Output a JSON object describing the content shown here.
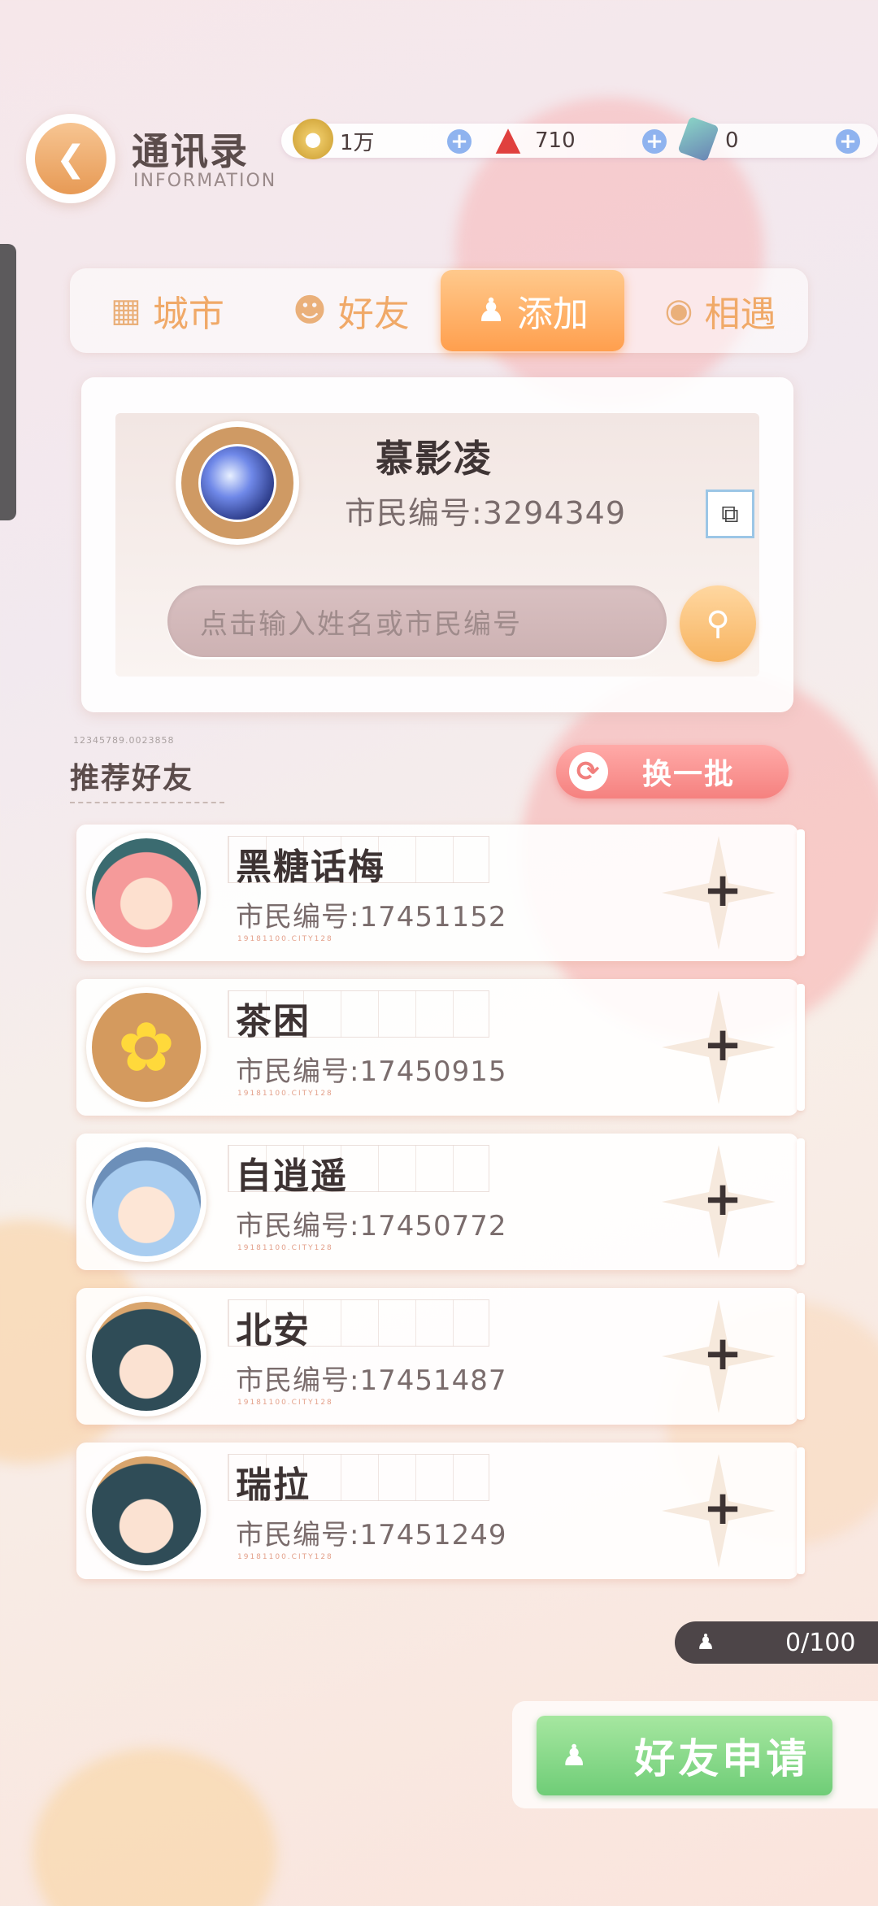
{
  "header": {
    "title": "通讯录",
    "subtitle": "INFORMATION"
  },
  "resources": [
    {
      "icon": "gold-coin-icon",
      "value": "1万"
    },
    {
      "icon": "fire-gem-icon",
      "value": "710"
    },
    {
      "icon": "card-ticket-icon",
      "value": "0"
    }
  ],
  "tabs": [
    {
      "label": "城市",
      "icon": "city-icon",
      "active": false
    },
    {
      "label": "好友",
      "icon": "friend-icon",
      "active": false
    },
    {
      "label": "添加",
      "icon": "add-user-icon",
      "active": true
    },
    {
      "label": "相遇",
      "icon": "encounter-icon",
      "active": false
    }
  ],
  "profile": {
    "name": "慕影凌",
    "citizen_id": "市民编号:3294349",
    "search_placeholder": "点击输入姓名或市民编号"
  },
  "recommend": {
    "code": "12345789.0023858",
    "title": "推荐好友",
    "refresh_label": "换一批"
  },
  "friends": [
    {
      "name": "黑糖话梅",
      "citizen_id": "市民编号:17451152",
      "avatar": "pink-hair-girl"
    },
    {
      "name": "茶困",
      "citizen_id": "市民编号:17450915",
      "avatar": "yellow-flower"
    },
    {
      "name": "自逍遥",
      "citizen_id": "市民编号:17450772",
      "avatar": "blue-hair-girl"
    },
    {
      "name": "北安",
      "citizen_id": "市民编号:17451487",
      "avatar": "dark-hair-boy"
    },
    {
      "name": "瑞拉",
      "citizen_id": "市民编号:17451249",
      "avatar": "dark-hair-boy"
    }
  ],
  "small_code": "19181100.CITY128",
  "requests": {
    "count": "0/100",
    "button_label": "好友申请"
  },
  "colors": {
    "accent_orange": "#ff9f4e",
    "refresh_red": "#f5817f",
    "apply_green": "#6fcd77"
  }
}
